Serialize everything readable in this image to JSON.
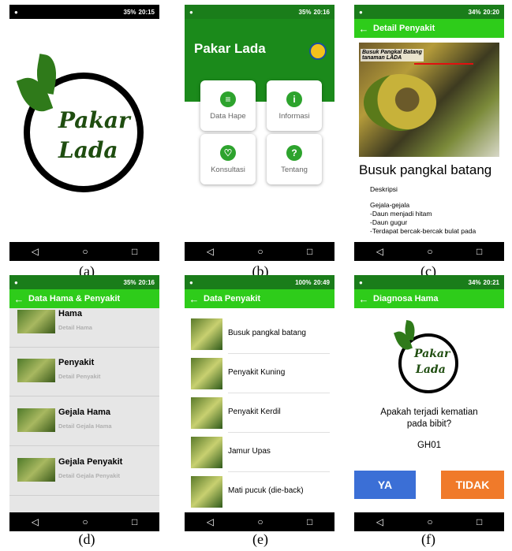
{
  "captions": [
    "(a)",
    "(b)",
    "(c)",
    "(d)",
    "(e)",
    "(f)"
  ],
  "status": {
    "a": {
      "right": "35%",
      "time": "20:15"
    },
    "b": {
      "right": "35%",
      "time": "20:16"
    },
    "c": {
      "right": "34%",
      "time": "20:20"
    },
    "d": {
      "right": "35%",
      "time": "20:16"
    },
    "e": {
      "right": "100%",
      "time": "20:49"
    },
    "f": {
      "right": "34%",
      "time": "20:21"
    }
  },
  "logo": {
    "line1": "Pakar",
    "line2": "Lada"
  },
  "nav": {
    "back": "◁",
    "home": "○",
    "recent": "□"
  },
  "screen_b": {
    "title": "Pakar Lada",
    "cards": [
      {
        "label": "Data Hape",
        "icon": "database-icon",
        "glyph": "≡"
      },
      {
        "label": "Informasi",
        "icon": "info-icon",
        "glyph": "i"
      },
      {
        "label": "Konsultasi",
        "icon": "stethoscope-icon",
        "glyph": "♡"
      },
      {
        "label": "Tentang",
        "icon": "help-icon",
        "glyph": "?"
      }
    ]
  },
  "screen_c": {
    "appbar": "Detail Penyakit",
    "image_annotation": {
      "line1": "Busuk Pangkal Batang",
      "line2": "tanaman LADA"
    },
    "title": "Busuk pangkal batang",
    "section": "Deskripsi",
    "lines": [
      "Gejala-gejala",
      "-Daun menjadi hitam",
      "-Daun gugur",
      "-Terdapat bercak-bercak bulat pada"
    ]
  },
  "screen_d": {
    "appbar": "Data Hama & Penyakit",
    "items": [
      {
        "title": "Hama",
        "subtitle": "Detail Hama"
      },
      {
        "title": "Penyakit",
        "subtitle": "Detail Penyakit"
      },
      {
        "title": "Gejala Hama",
        "subtitle": "Detail Gejala Hama"
      },
      {
        "title": "Gejala Penyakit",
        "subtitle": "Detail Gejala Penyakit"
      }
    ]
  },
  "screen_e": {
    "appbar": "Data Penyakit",
    "items": [
      "Busuk pangkal batang",
      "Penyakit Kuning",
      "Penyakit Kerdil",
      "Jamur Upas",
      "Mati pucuk (die-back)"
    ]
  },
  "screen_f": {
    "appbar": "Diagnosa Hama",
    "question_line1": "Apakah terjadi kematian",
    "question_line2": "pada bibit?",
    "code": "GH01",
    "yes": "YA",
    "no": "TIDAK"
  },
  "colors": {
    "green_bar": "#2ecc1a",
    "dark_green": "#1b8a1b",
    "yes_button": "#3b6fd6",
    "no_button": "#f07a2a"
  }
}
